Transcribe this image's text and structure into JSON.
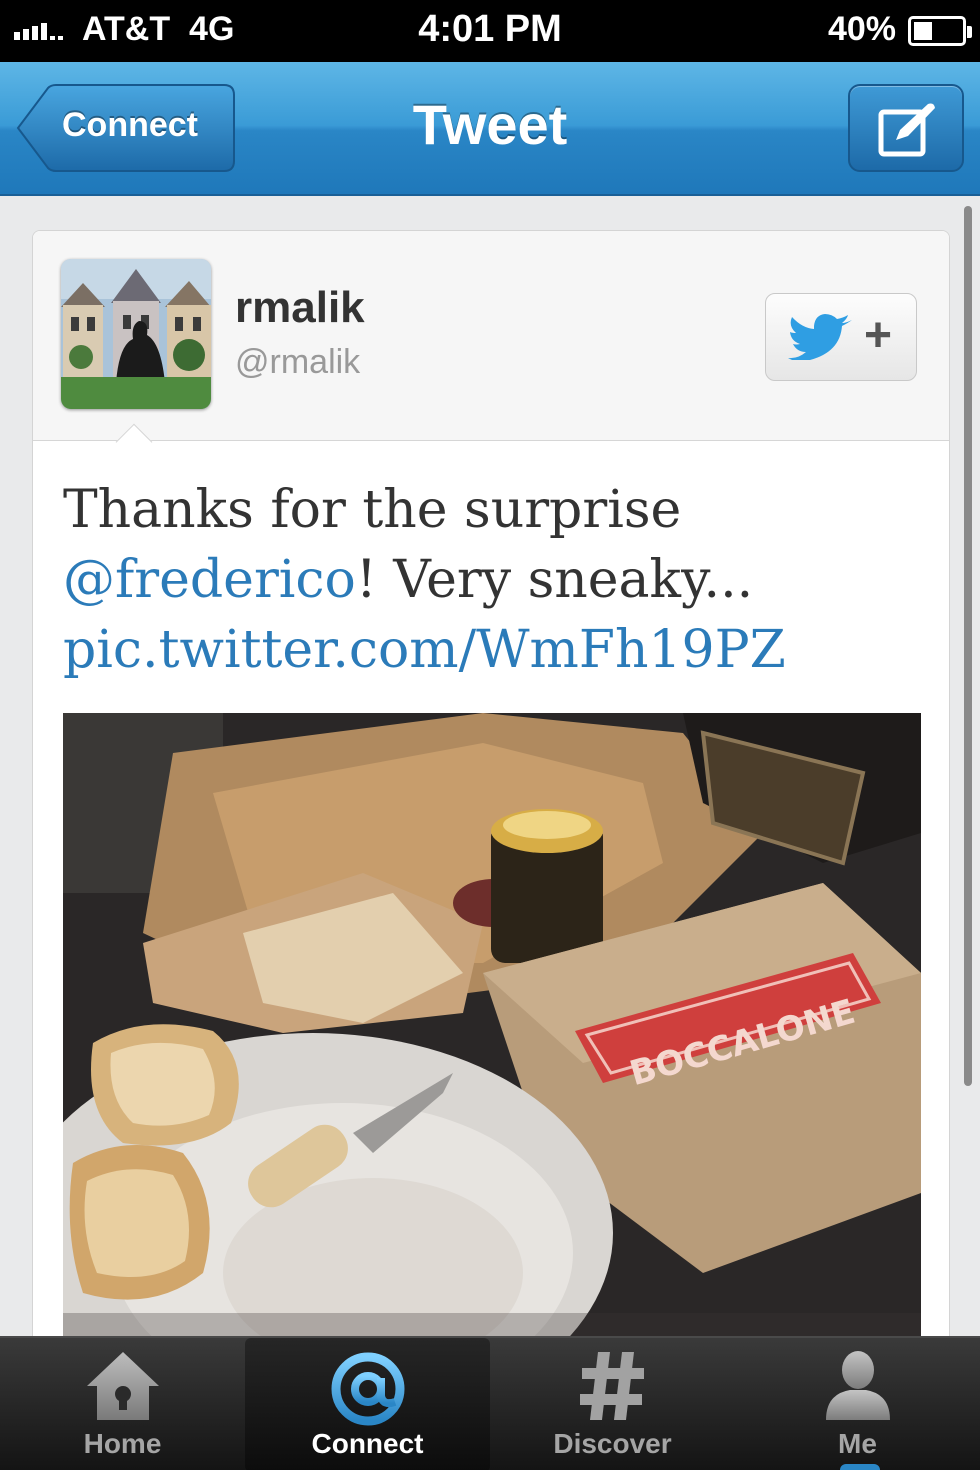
{
  "status_bar": {
    "carrier": "AT&T",
    "network": "4G",
    "time": "4:01 PM",
    "battery": "40%",
    "battery_level": 0.4
  },
  "nav": {
    "back_label": "Connect",
    "title": "Tweet",
    "compose_icon": "compose-icon"
  },
  "tweet": {
    "display_name": "rmalik",
    "handle": "@rmalik",
    "text_before": "Thanks for the surprise ",
    "mention": "@frederico",
    "text_after": "! Very sneaky... ",
    "link": "pic.twitter.com/WmFh19PZ",
    "photo_label": "BOCCALONE"
  },
  "colors": {
    "nav_blue": "#2a86c6",
    "link_blue": "#2b7bb9",
    "tab_bar": "#141414"
  },
  "tabs": [
    {
      "label": "Home",
      "icon": "home-icon",
      "active": false
    },
    {
      "label": "Connect",
      "icon": "at-icon",
      "active": true
    },
    {
      "label": "Discover",
      "icon": "hash-icon",
      "active": false
    },
    {
      "label": "Me",
      "icon": "person-icon",
      "active": false
    }
  ]
}
